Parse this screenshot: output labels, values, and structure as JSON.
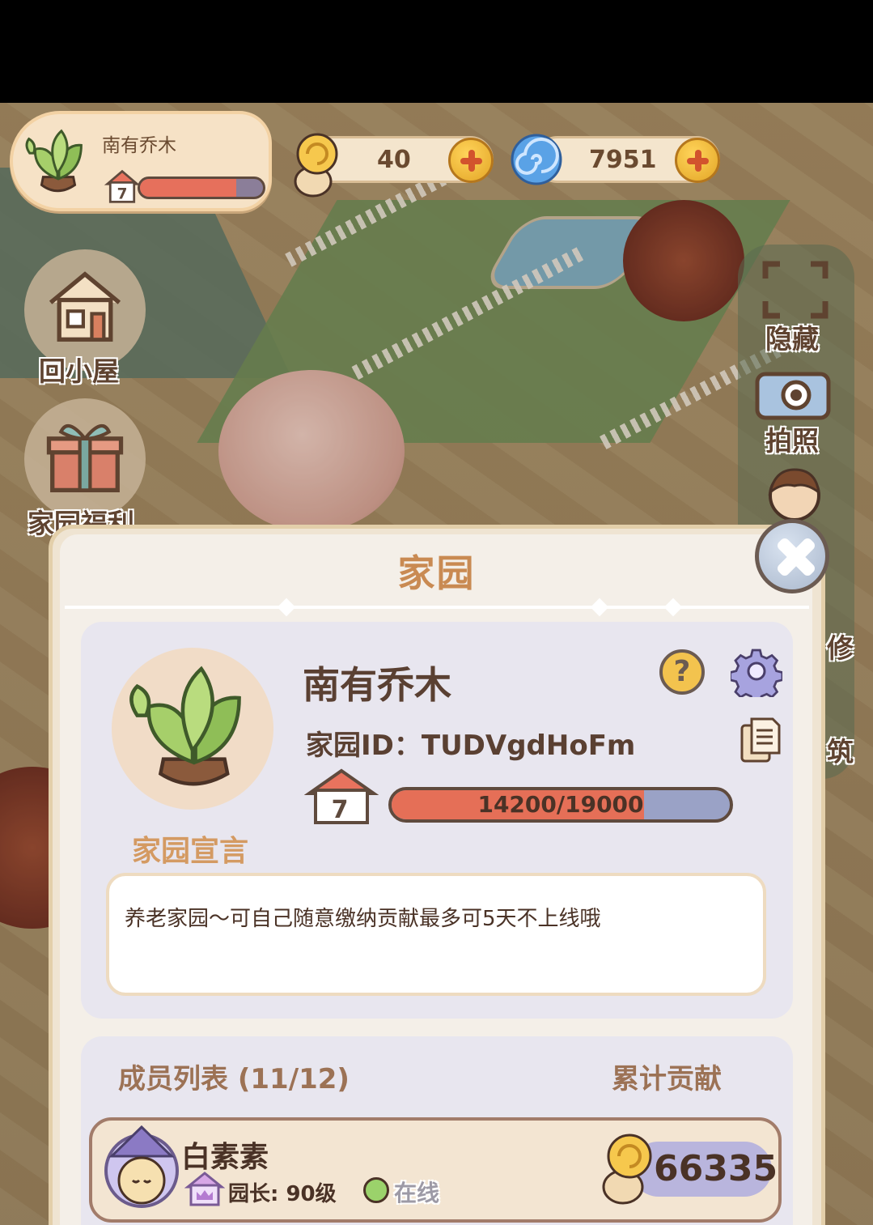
{
  "hud": {
    "home_name": "南有乔木",
    "level": "7",
    "level_progress": 0.78,
    "snail_coins": "40",
    "swirl_coins": "7951"
  },
  "side_buttons": {
    "back_home": "回小屋",
    "welfare": "家园福利",
    "hide": "隐藏",
    "photo": "拍照",
    "repair_partial": "修",
    "build_partial": "筑"
  },
  "dialog": {
    "title": "家园",
    "home_name": "南有乔木",
    "home_id": "家园ID：TUDVgdHoFm",
    "level": "7",
    "exp_text": "14200/19000",
    "exp_current": 14200,
    "exp_max": 19000,
    "motto_label": "家园宣言",
    "motto_text": "养老家园～可自己随意缴纳贡献最多可5天不上线哦",
    "help_label": "?"
  },
  "members": {
    "header": "成员列表 (11/12)",
    "contrib_header": "累计贡献",
    "list": [
      {
        "name": "白素素",
        "role": "园长: 90级",
        "status": "在线",
        "contribution": "66335"
      }
    ]
  },
  "colors": {
    "accent": "#c98a52",
    "exp_fill": "#e56f57",
    "online": "#9bd26b",
    "dialog_bg": "#f4efe8"
  }
}
